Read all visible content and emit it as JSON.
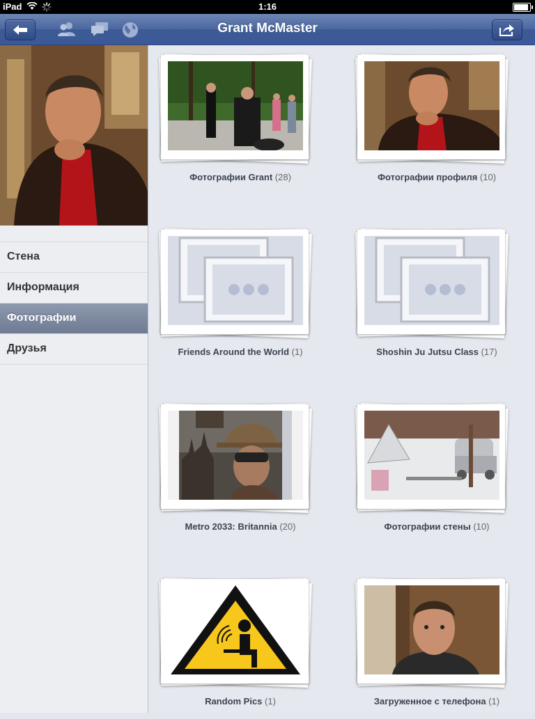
{
  "status": {
    "device": "iPad",
    "time": "1:16"
  },
  "nav": {
    "title": "Grant McMaster",
    "back_icon": "back-arrow-icon",
    "share_icon": "share-icon"
  },
  "sidebar": {
    "items": [
      {
        "label": "Стена",
        "active": false
      },
      {
        "label": "Информация",
        "active": false
      },
      {
        "label": "Фотографии",
        "active": true
      },
      {
        "label": "Друзья",
        "active": false
      }
    ]
  },
  "albums": [
    {
      "name": "Фотографии Grant",
      "count": "(28)",
      "thumb": "group-photo"
    },
    {
      "name": "Фотографии профиля",
      "count": "(10)",
      "thumb": "profile-photo"
    },
    {
      "name": "Friends Around the World",
      "count": "(1)",
      "thumb": "placeholder"
    },
    {
      "name": "Shoshin Ju Jutsu Class",
      "count": "(17)",
      "thumb": "placeholder"
    },
    {
      "name": "Metro 2033: Britannia",
      "count": "(20)",
      "thumb": "metro-art"
    },
    {
      "name": "Фотографии стены",
      "count": "(10)",
      "thumb": "snow-yard"
    },
    {
      "name": "Random Pics",
      "count": "(1)",
      "thumb": "warning-sign"
    },
    {
      "name": "Загруженное с телефона",
      "count": "(1)",
      "thumb": "face-photo"
    }
  ]
}
